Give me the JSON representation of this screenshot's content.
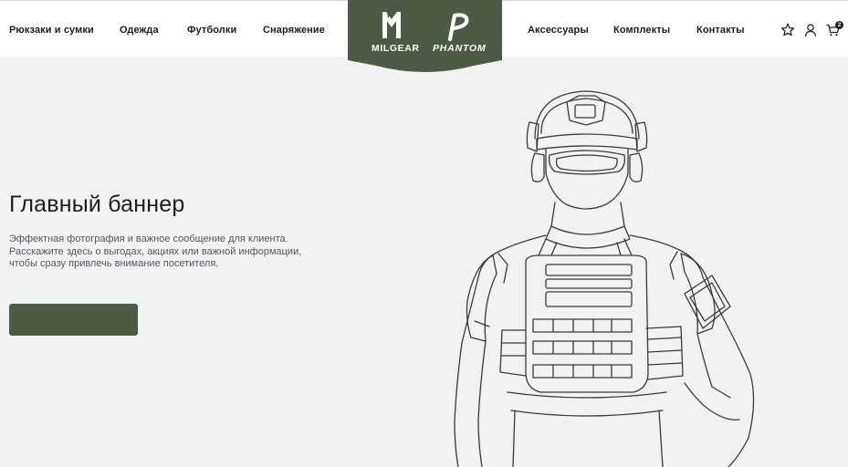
{
  "nav": {
    "left": [
      "Рюкзаки и сумки",
      "Одежда",
      "Футболки",
      "Снаряжение"
    ],
    "right": [
      "Аксессуары",
      "Комплекты",
      "Контакты"
    ]
  },
  "logo": {
    "brand_left": "MILGEAR",
    "brand_right": "PHANTOM"
  },
  "icons": {
    "favorites": "star-icon",
    "account": "user-icon",
    "cart": "cart-icon"
  },
  "cart": {
    "count": "2"
  },
  "hero": {
    "title": "Главный баннер",
    "text": "Эффектная фотография и важное сообщение для клиента. Расскажите здесь о выгодах, акциях или важной информации, чтобы сразу привлечь внимание посетителя.",
    "button_label": ""
  },
  "colors": {
    "accent": "#4d5b46",
    "header_bg": "#ffffff",
    "page_bg": "#f1f2f4",
    "text": "#1d1d1f"
  }
}
